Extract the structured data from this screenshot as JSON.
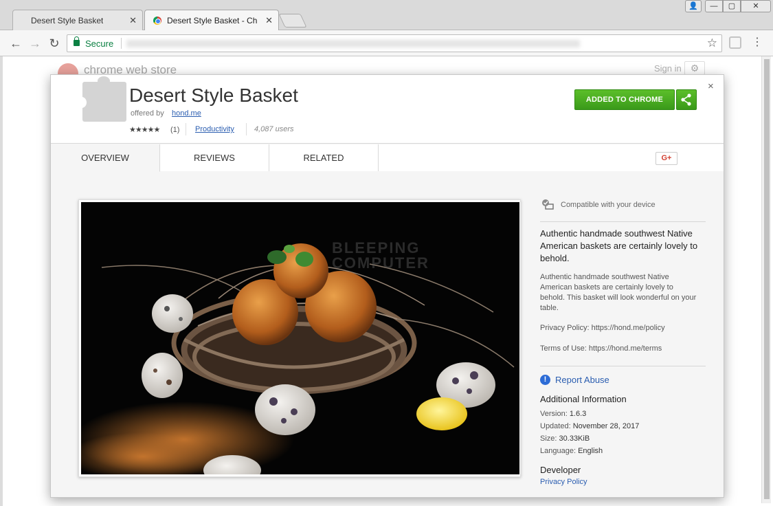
{
  "browser": {
    "tabs": [
      {
        "title": "Desert Style Basket",
        "active": false
      },
      {
        "title": "Desert Style Basket - Chr",
        "active": true
      }
    ],
    "security_label": "Secure",
    "window_controls": {
      "user": "👤",
      "minimize": "—",
      "maximize": "▢",
      "close": "✕"
    }
  },
  "store": {
    "name": "chrome web store",
    "signin": "Sign in"
  },
  "extension": {
    "title": "Desert Style Basket",
    "offered_by": "offered by",
    "developer": "hond.me",
    "stars": "★★★★★",
    "rating_count": "(1)",
    "category": "Productivity",
    "users": "4,087 users",
    "add_button": "ADDED TO CHROME",
    "close": "×"
  },
  "tabs": [
    {
      "label": "OVERVIEW",
      "active": true
    },
    {
      "label": "REVIEWS",
      "active": false
    },
    {
      "label": "RELATED",
      "active": false
    }
  ],
  "gplus": "G+",
  "sidebar": {
    "compat": "Compatible with your device",
    "summary": "Authentic handmade southwest Native American baskets are certainly lovely to behold.",
    "description": "Authentic handmade southwest Native American baskets are certainly lovely to behold. This basket will look wonderful on your table.",
    "privacy_policy": "Privacy Policy: https://hond.me/policy",
    "terms": "Terms of Use: https://hond.me/terms",
    "report_abuse": "Report Abuse",
    "additional_info_title": "Additional Information",
    "info": [
      {
        "label": "Version:",
        "value": "1.6.3"
      },
      {
        "label": "Updated:",
        "value": "November 28, 2017"
      },
      {
        "label": "Size:",
        "value": "30.33KiB"
      },
      {
        "label": "Language:",
        "value": "English"
      }
    ],
    "developer_title": "Developer",
    "developer_link": "Privacy Policy"
  },
  "colors": {
    "accent_green": "#4cae22",
    "link_blue": "#2a5db0",
    "secure_green": "#0b8043"
  },
  "icons": [
    "back-arrow-icon",
    "forward-arrow-icon",
    "reload-icon",
    "lock-icon",
    "star-icon",
    "puzzle-icon",
    "share-icon",
    "checkmark-device-icon",
    "alert-icon",
    "gear-icon"
  ]
}
